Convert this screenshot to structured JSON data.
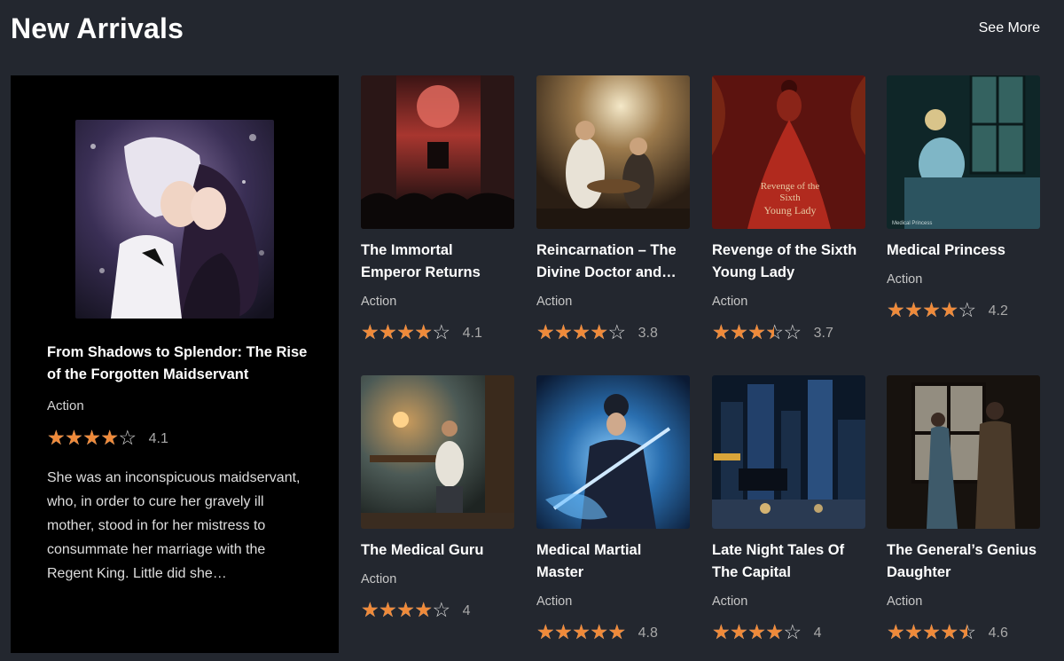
{
  "header": {
    "title": "New Arrivals",
    "see_more": "See More"
  },
  "featured": {
    "title": "From Shadows to Splendor: The Rise of the Forgotten Maidservant",
    "genre": "Action",
    "rating": 4.1,
    "rating_label": "4.1",
    "stars_fraction": 0.8,
    "description": "She was an inconspicuous maidservant, who, in order to cure her gravely ill mother, stood in for her mistress to consummate her marriage with the Regent King. Little did she…"
  },
  "books": [
    {
      "title": "The Immortal Emperor Returns",
      "genre": "Action",
      "rating": 4.1,
      "rating_label": "4.1",
      "stars_fraction": 0.8,
      "cover_theme": "red-moon-throne"
    },
    {
      "title": "Reincarnation – The Divine Doctor and…",
      "genre": "Action",
      "rating": 3.8,
      "rating_label": "3.8",
      "stars_fraction": 0.8,
      "cover_theme": "sepia-study"
    },
    {
      "title": "Revenge of the Sixth Young Lady",
      "genre": "Action",
      "rating": 3.7,
      "rating_label": "3.7",
      "stars_fraction": 0.7,
      "cover_theme": "red-gown",
      "cover_text": [
        "Revenge of the",
        "Sixth",
        "Young Lady"
      ]
    },
    {
      "title": "Medical Princess",
      "genre": "Action",
      "rating": 4.2,
      "rating_label": "4.2",
      "stars_fraction": 0.8,
      "cover_theme": "teal-bed",
      "cover_text": [
        "Medical Princess"
      ]
    },
    {
      "title": "The Medical Guru",
      "genre": "Action",
      "rating": 4,
      "rating_label": "4",
      "stars_fraction": 0.8,
      "cover_theme": "lamp-desk"
    },
    {
      "title": "Medical Martial Master",
      "genre": "Action",
      "rating": 4.8,
      "rating_label": "4.8",
      "stars_fraction": 1.0,
      "cover_theme": "blue-warrior"
    },
    {
      "title": "Late Night Tales Of The Capital",
      "genre": "Action",
      "rating": 4,
      "rating_label": "4",
      "stars_fraction": 0.8,
      "cover_theme": "night-city"
    },
    {
      "title": "The General’s Genius Daughter",
      "genre": "Action",
      "rating": 4.6,
      "rating_label": "4.6",
      "stars_fraction": 0.9,
      "cover_theme": "window-couple"
    }
  ],
  "colors": {
    "background": "#23272f",
    "featured_bg": "#000000",
    "star": "#ef8a3a",
    "star_empty": "#d7d7d7"
  }
}
